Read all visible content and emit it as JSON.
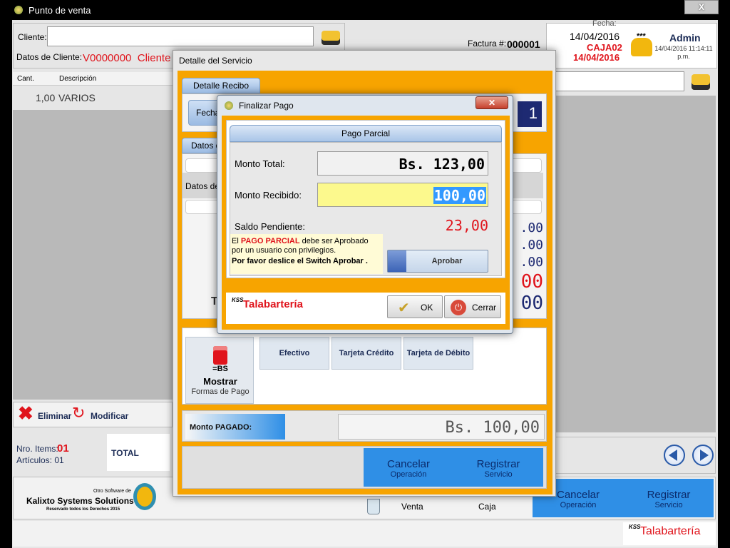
{
  "window": {
    "title": "Punto de venta",
    "close_label": "X"
  },
  "header": {
    "cliente_label": "Cliente:",
    "cliente_value": "",
    "datos_label": "Datos de Cliente:",
    "datos_value": "V0000000  Cliente",
    "factura_label": "Factura #:",
    "factura_value": "000001",
    "fecha_label": "Fecha:",
    "date1": "14/04/2016",
    "caja": "CAJA02",
    "date2": "14/04/2016",
    "stars": "***",
    "user": "Admin",
    "user_datetime": "14/04/2016 11:14:11 p.m."
  },
  "table": {
    "columns": [
      "Cant.",
      "Descripción"
    ],
    "rows": [
      {
        "cant": "1,00",
        "desc": "VARIOS"
      }
    ]
  },
  "actions": {
    "delete": "Eliminar",
    "modify": "Modificar"
  },
  "summary": {
    "items_label": "Nro. Items:",
    "items_value": "01",
    "articles_label": "Artículos: 01",
    "total_label": "TOTAL"
  },
  "footer": {
    "other_software": "Otro Software de",
    "company": "Kalixto Systems Solutions",
    "rights": "Reservado todos los Derechos 2015",
    "venta_label": "Venta",
    "caja_label": "Caja",
    "cancel_title": "Cancelar",
    "cancel_sub": "Operación",
    "register_title": "Registrar",
    "register_sub": "Servicio",
    "brand_prefix": "KSS",
    "brand": "Talabartería"
  },
  "detalle": {
    "title": "Detalle del Servicio",
    "tab_recibo": "Detalle Recibo",
    "fecha_short": "Fecha",
    "recibo_number": "1",
    "tab_datos": "Datos d",
    "datos_de": "Datos de",
    "partial_values": [
      ".00",
      ".00",
      ".00",
      "00",
      "00"
    ],
    "t_label": "T",
    "mostrar": "Mostrar",
    "formas": "Formas de Pago",
    "bs_label": "=BS",
    "pay_methods": [
      "Efectivo",
      "Tarjeta Crédito",
      "Tarjeta de Débito"
    ],
    "monto_pagado_label": "Monto PAGADO:",
    "monto_pagado_value": "Bs. 100,00",
    "cancel_title": "Cancelar",
    "cancel_sub": "Operación",
    "register_title": "Registrar",
    "register_sub": "Servicio"
  },
  "finalizar": {
    "title": "Finalizar Pago",
    "section": "Pago Parcial",
    "monto_total_label": "Monto Total:",
    "monto_total_value": "Bs. 123,00",
    "monto_recibido_label": "Monto Recibido:",
    "monto_recibido_value": "100,00",
    "saldo_label": "Saldo Pendiente:",
    "saldo_value": "23,00",
    "msg_prefix": "El",
    "msg_highlight": "PAGO PARCIAL",
    "msg_suffix": "debe ser Aprobado",
    "msg_line2": "por un usuario con privilegios.",
    "msg_line3": "Por favor deslice el Switch Aprobar .",
    "aprobar": "Aprobar",
    "brand_prefix": "KSS",
    "brand": "Talabartería",
    "ok": "OK",
    "cerrar": "Cerrar"
  },
  "colors": {
    "orange": "#f7a400",
    "accent_blue": "#2f8fe6",
    "red": "#e0141c"
  }
}
